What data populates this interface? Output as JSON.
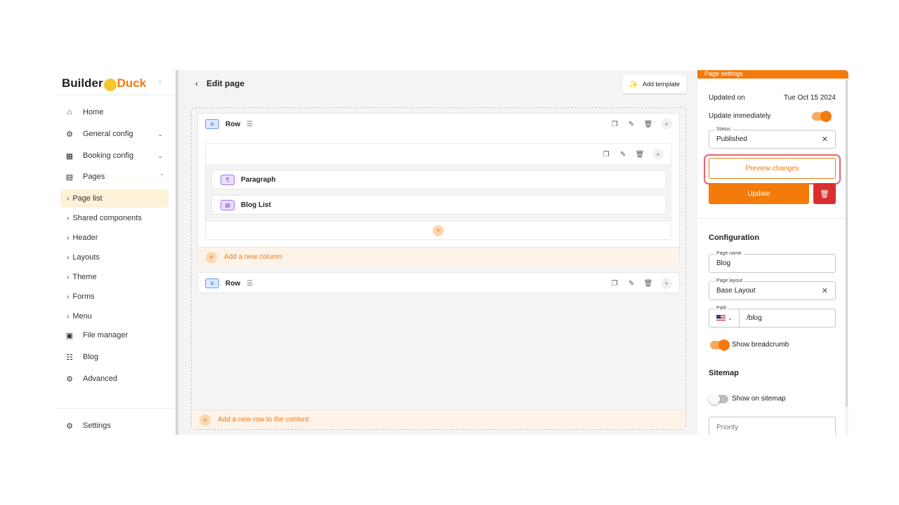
{
  "brand": {
    "part1": "Builder",
    "part2": "Duck"
  },
  "sidebar": {
    "collapse_icon": "chevron-left-icon",
    "nav": [
      {
        "label": "Home",
        "icon": "home-icon"
      },
      {
        "label": "General config",
        "icon": "gear-icon"
      },
      {
        "label": "Booking config",
        "icon": "calendar-icon"
      },
      {
        "label": "Pages",
        "icon": "pages-icon"
      }
    ],
    "pages_sub": [
      "Page list",
      "Shared components",
      "Header",
      "Layouts",
      "Theme",
      "Forms",
      "Menu"
    ],
    "nav2": [
      {
        "label": "File manager",
        "icon": "folder-icon"
      },
      {
        "label": "Blog",
        "icon": "document-icon"
      },
      {
        "label": "Advanced",
        "icon": "advanced-gear-icon"
      }
    ],
    "settings": "Settings"
  },
  "main": {
    "title": "Edit page",
    "add_template": "Add template",
    "row1": {
      "label": "Row"
    },
    "components": [
      "Paragraph",
      "Blog List"
    ],
    "add_column": "Add a new column",
    "row2": {
      "label": "Row"
    },
    "add_row": "Add a new row to the content"
  },
  "panel": {
    "tab": "Page settings",
    "updated_on_label": "Updated on",
    "updated_on_value": "Tue Oct 15 2024",
    "update_immediately": "Update immediately",
    "status_label": "Status",
    "status_value": "Published",
    "preview": "Preview changes",
    "update": "Update",
    "configuration": "Configuration",
    "page_name_label": "Page name",
    "page_name_value": "Blog",
    "page_layout_label": "Page layout",
    "page_layout_value": "Base Layout",
    "path_label": "Path",
    "path_value": "/blog",
    "show_breadcrumb": "Show breadcrumb",
    "sitemap": "Sitemap",
    "show_on_sitemap": "Show on sitemap",
    "priority_placeholder": "Priority"
  },
  "colors": {
    "accent": "#f47a0c",
    "danger": "#d9302f",
    "highlight": "#ec5f6e"
  }
}
